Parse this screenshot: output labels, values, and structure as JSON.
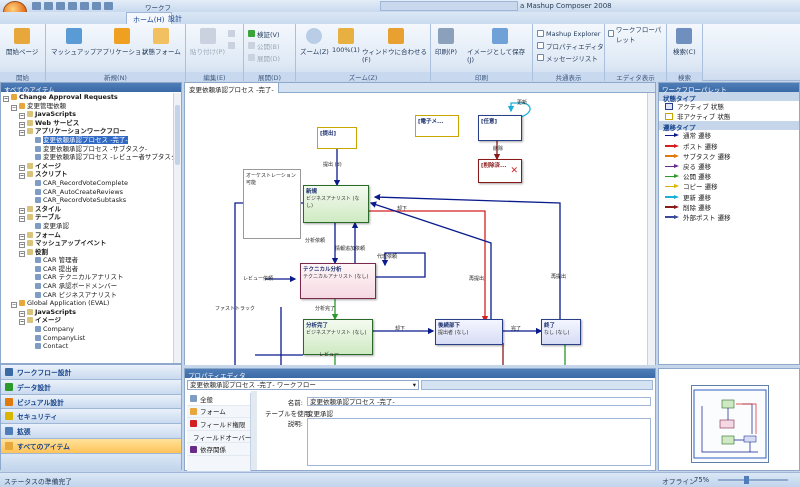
{
  "window_title": "a Mashup Composer 2008",
  "tabs": [
    "ホーム(H)",
    "設計"
  ],
  "ribbon": {
    "groups": [
      {
        "label": "開始",
        "items": [
          "開始ページ"
        ]
      },
      {
        "label": "新規(N)",
        "items": [
          "マッシュアップ",
          "アプリケーション",
          "状態フォーム"
        ]
      },
      {
        "label": "編集(E)",
        "items": [
          "貼り付け(P)"
        ]
      },
      {
        "label": "展開(D)",
        "items": [
          "検証(V)",
          "公開(B)",
          "展開(D)"
        ]
      },
      {
        "label": "ズーム(Z)",
        "items": [
          "ズーム(Z)",
          "100%(1)",
          "ウィンドウに合わせる(F)"
        ]
      },
      {
        "label": "印刷",
        "items": [
          "印刷(P)",
          "イメージとして保存(J)"
        ]
      },
      {
        "label": "共通表示",
        "items": [
          "Mashup Explorer",
          "プロパティエディタ",
          "メッセージリスト"
        ]
      },
      {
        "label": "エディタ表示",
        "items": [
          "ワークフローパレット"
        ]
      },
      {
        "label": "検索",
        "items": [
          "検索(C)"
        ]
      }
    ],
    "qat_label": "ワークフ"
  },
  "left_panel": {
    "title": "すべてのアイテム",
    "tree": [
      {
        "text": "Change Approval Requests",
        "level": 0,
        "bold": true
      },
      {
        "text": "変更管理依頼",
        "level": 1,
        "bold": false
      },
      {
        "text": "JavaScripts",
        "level": 2,
        "bold": true
      },
      {
        "text": "Web サービス",
        "level": 2,
        "bold": true
      },
      {
        "text": "アプリケーションワークフロー",
        "level": 2,
        "bold": true
      },
      {
        "text": "変更依頼承認プロセス -完了-",
        "level": 3,
        "bold": false,
        "selected": true
      },
      {
        "text": "変更依頼承認プロセス -サブタスク-",
        "level": 3,
        "bold": false
      },
      {
        "text": "変更依頼承認プロセス -レビュー者サブタスク-",
        "level": 3,
        "bold": false
      },
      {
        "text": "イメージ",
        "level": 2,
        "bold": true
      },
      {
        "text": "スクリプト",
        "level": 2,
        "bold": true
      },
      {
        "text": "CAR_RecordVoteComplete",
        "level": 3,
        "bold": false
      },
      {
        "text": "CAR_AutoCreateReviews",
        "level": 3,
        "bold": false
      },
      {
        "text": "CAR_RecordVoteSubtasks",
        "level": 3,
        "bold": false
      },
      {
        "text": "スタイル",
        "level": 2,
        "bold": true
      },
      {
        "text": "テーブル",
        "level": 2,
        "bold": true
      },
      {
        "text": "変更承認",
        "level": 3,
        "bold": false
      },
      {
        "text": "フォーム",
        "level": 2,
        "bold": true
      },
      {
        "text": "マッシュアップイベント",
        "level": 2,
        "bold": true
      },
      {
        "text": "役割",
        "level": 2,
        "bold": true
      },
      {
        "text": "CAR 管理者",
        "level": 3,
        "bold": false
      },
      {
        "text": "CAR 提出者",
        "level": 3,
        "bold": false
      },
      {
        "text": "CAR テクニカルアナリスト",
        "level": 3,
        "bold": false
      },
      {
        "text": "CAR 承認ボードメンバー",
        "level": 3,
        "bold": false
      },
      {
        "text": "CAR ビジネスアナリスト",
        "level": 3,
        "bold": false
      },
      {
        "text": "Global Application (EVAL)",
        "level": 1,
        "bold": false
      },
      {
        "text": "JavaScripts",
        "level": 2,
        "bold": true
      },
      {
        "text": "イメージ",
        "level": 2,
        "bold": true
      },
      {
        "text": "Company",
        "level": 3,
        "bold": false
      },
      {
        "text": "CompanyList",
        "level": 3,
        "bold": false
      },
      {
        "text": "Contact",
        "level": 3,
        "bold": false
      }
    ]
  },
  "nav_buttons": [
    "ワークフロー設計",
    "データ設計",
    "ビジュアル設計",
    "セキュリティ",
    "拡張",
    "すべてのアイテム"
  ],
  "document": {
    "tab_title": "変更依頼承認プロセス -完了-",
    "nodes": [
      {
        "title": "[提出]",
        "type": "start"
      },
      {
        "title": "[電子メ...",
        "type": "email"
      },
      {
        "title": "[任意]",
        "type": "any"
      },
      {
        "title": "[削除済...",
        "type": "deleted"
      },
      {
        "title": "新規",
        "sub": "ビジネスアナリスト (なし)",
        "type": "green"
      },
      {
        "title": "テクニカル分析",
        "sub": "テクニカルアナリスト (なし)",
        "type": "pink"
      },
      {
        "title": "分析完了",
        "sub": "ビジネスアナリスト (なし)",
        "type": "green"
      },
      {
        "title": "後続部下",
        "sub": "提出者 (なし)",
        "type": "blue"
      },
      {
        "title": "終了",
        "sub": "なし (なし)",
        "type": "blue"
      }
    ],
    "note": "オーケストレーション可能",
    "edge_labels": [
      "更新",
      "削除",
      "提出 (d)",
      "却下",
      "分析依頼",
      "情報追加依頼",
      "代理依頼",
      "再提出",
      "再提出",
      "分析完了",
      "却下",
      "完了",
      "レビュー依頼",
      "ファストトラック",
      "レビュー"
    ]
  },
  "palette": {
    "title": "ワークフローパレット",
    "state_header": "状態タイプ",
    "states": [
      "アクティブ 状態",
      "非アクティブ 状態"
    ],
    "transition_header": "遷移タイプ",
    "transitions": [
      {
        "label": "通常 遷移",
        "color": "#0a1b8c"
      },
      {
        "label": "ポスト 遷移",
        "color": "#d42020"
      },
      {
        "label": "サブタスク 遷移",
        "color": "#e07a10"
      },
      {
        "label": "戻る 遷移",
        "color": "#6a2a8a"
      },
      {
        "label": "公開 遷移",
        "color": "#2a9a2a"
      },
      {
        "label": "コピー 遷移",
        "color": "#d9b400"
      },
      {
        "label": "更新 遷移",
        "color": "#1ab0d8"
      },
      {
        "label": "削除 遷移",
        "color": "#8a1a1a"
      },
      {
        "label": "外部ポスト 遷移",
        "color": "#3a4a9a"
      }
    ]
  },
  "property_editor": {
    "title": "プロパティエディタ",
    "combo_value": "変更依頼承認プロセス -完了-",
    "combo_type": "ワークフロー",
    "sections": [
      "全般",
      "フォーム",
      "フィールド権限",
      "フィールドオーバーラ",
      "依存関係"
    ],
    "fields": [
      {
        "label": "名前:",
        "value": "変更依頼承認プロセス -完了-"
      },
      {
        "label": "テーブルを使用:",
        "value": "変更承認"
      },
      {
        "label": "説明:",
        "value": ""
      }
    ]
  },
  "status": {
    "left": "ステータスの準備完了",
    "mode": "オフライン",
    "zoom": "75%"
  }
}
